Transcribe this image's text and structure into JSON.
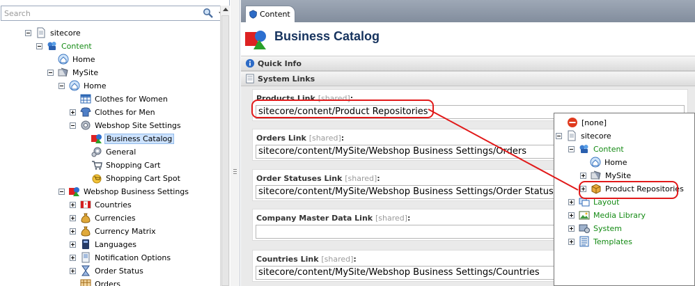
{
  "search": {
    "placeholder": "Search"
  },
  "tree": {
    "sitecore": "sitecore",
    "content": "Content",
    "home_root": "Home",
    "mysite": "MySite",
    "home": "Home",
    "clothes_women": "Clothes for Women",
    "clothes_men": "Clothes for Men",
    "webshop_site_settings": "Webshop Site Settings",
    "business_catalog": "Business Catalog",
    "general": "General",
    "shopping_cart": "Shopping Cart",
    "shopping_cart_spot": "Shopping Cart Spot",
    "webshop_business_settings": "Webshop Business Settings",
    "countries": "Countries",
    "currencies": "Currencies",
    "currency_matrix": "Currency Matrix",
    "languages": "Languages",
    "notification_options": "Notification Options",
    "order_status": "Order Status",
    "orders": "Orders"
  },
  "editor": {
    "tab_label": "Content",
    "title": "Business Catalog",
    "quick_info": "Quick Info",
    "system_links": "System Links",
    "shared_tag": "[shared]",
    "fields": [
      {
        "label": "Products Link",
        "value": "sitecore/content/Product Repositories"
      },
      {
        "label": "Orders Link",
        "value": "sitecore/content/MySite/Webshop Business Settings/Orders"
      },
      {
        "label": "Order Statuses Link",
        "value": "sitecore/content/MySite/Webshop Business Settings/Order Status"
      },
      {
        "label": "Company Master Data Link",
        "value": ""
      },
      {
        "label": "Countries Link",
        "value": "sitecore/content/MySite/Webshop Business Settings/Countries"
      }
    ]
  },
  "popup": {
    "none": "[none]",
    "sitecore": "sitecore",
    "content": "Content",
    "home": "Home",
    "mysite": "MySite",
    "product_repositories": "Product Repositories",
    "layout": "Layout",
    "media_library": "Media Library",
    "system": "System",
    "templates": "Templates"
  },
  "colors": {
    "highlight_red": "#e11919",
    "green_item": "#138a13",
    "title_blue": "#16335e",
    "selection": "#cde3ff"
  },
  "icons": {
    "search": "search-icon",
    "page": "page-icon",
    "content": "content-icon",
    "home": "home-icon",
    "site": "site-icon",
    "catalog": "catalog-icon",
    "settings": "gear-icon",
    "cart": "cart-icon",
    "box": "box-icon",
    "flag": "flag-icon",
    "money": "money-bag-icon",
    "book": "book-icon",
    "message": "message-icon",
    "hourglass": "hourglass-icon",
    "orders": "orders-icon",
    "info": "info-icon",
    "none": "none-icon"
  }
}
